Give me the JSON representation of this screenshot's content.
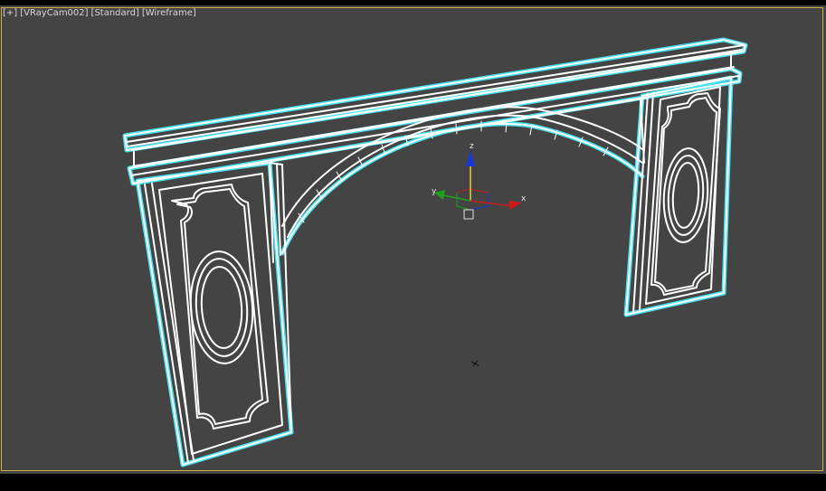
{
  "viewport": {
    "menu_plus": "[+]",
    "camera_label": "[VRayCam002]",
    "shading_preset": "[Standard]",
    "display_mode": "[Wireframe]"
  },
  "gizmo": {
    "z_label": "z",
    "x_label": "x",
    "y_label": "y"
  },
  "colors": {
    "viewport_bg": "#444444",
    "viewport_border": "#c8b248",
    "wire_white": "#ffffff",
    "selection_cyan": "#45e0f0",
    "axis_z": "#1a35d8",
    "axis_x": "#c81a1a",
    "axis_y": "#1ea01e"
  }
}
